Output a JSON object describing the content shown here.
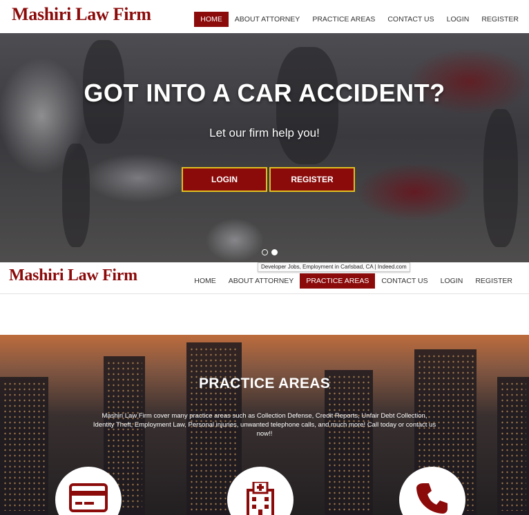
{
  "brand": {
    "name": "Mashiri Law Firm"
  },
  "top_nav": {
    "items": [
      {
        "label": "HOME"
      },
      {
        "label": "ABOUT ATTORNEY"
      },
      {
        "label": "PRACTICE AREAS"
      },
      {
        "label": "CONTACT US"
      },
      {
        "label": "LOGIN"
      },
      {
        "label": "REGISTER"
      }
    ],
    "active": "HOME"
  },
  "hero": {
    "title": "GOT INTO A CAR ACCIDENT?",
    "subtitle": "Let our firm help you!",
    "login_label": "LOGIN",
    "register_label": "REGISTER",
    "slides": 2,
    "active_slide": 2
  },
  "tooltip": {
    "text": "Developer Jobs, Employment in Carlsbad, CA | Indeed.com"
  },
  "sticky_nav": {
    "items": [
      {
        "label": "HOME"
      },
      {
        "label": "ABOUT ATTORNEY"
      },
      {
        "label": "PRACTICE AREAS"
      },
      {
        "label": "CONTACT US"
      },
      {
        "label": "LOGIN"
      },
      {
        "label": "REGISTER"
      }
    ],
    "active": "PRACTICE AREAS"
  },
  "practice": {
    "title": "PRACTICE AREAS",
    "description": "Mashiri Law Firm cover many practice areas such as Collection Defense, Credit Reports, Unfair Debt Collection, Identity Theft, Employment Law, Personal injuries, unwanted telephone calls, and much more! Call today or contact us now!!",
    "icons": [
      "credit-card-icon",
      "hospital-icon",
      "phone-icon"
    ]
  },
  "colors": {
    "brand": "#8b0a0a",
    "button_border": "#e0c020",
    "nav_text": "#333333"
  }
}
